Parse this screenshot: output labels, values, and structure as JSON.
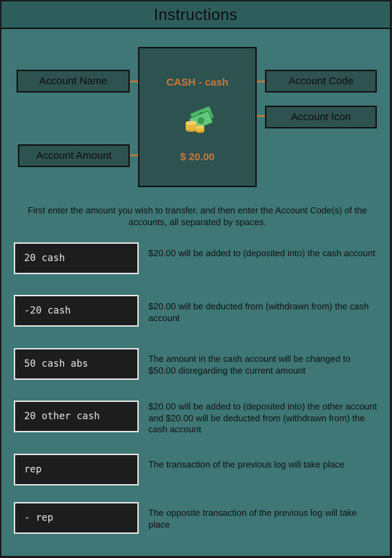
{
  "title": "Instructions",
  "card": {
    "name": "CASH - cash",
    "amount": "$ 20.00",
    "icon": "cash-coins-icon"
  },
  "labels": {
    "account_name": "Account Name",
    "account_code": "Account Code",
    "account_icon": "Account Icon",
    "account_amount": "Account Amount"
  },
  "intro": "First enter the amount you wish to transfer, and then enter the Account Code(s) of the accounts, all separated by spaces.",
  "examples": [
    {
      "command": "20 cash",
      "description": "$20.00 will be added to (deposited into) the cash account"
    },
    {
      "command": "-20 cash",
      "description": "$20.00 will be deducted from (withdrawn from) the cash account"
    },
    {
      "command": "50 cash abs",
      "description": "The amount in the cash account will be changed to $50.00 disregarding the current amount"
    },
    {
      "command": "20 other cash",
      "description": "$20.00 will be added to (deposited into) the other account and $20.00 will be deducted from (withdrawn from) the cash account"
    },
    {
      "command": "rep",
      "description": "The transaction of the previous log will take place"
    },
    {
      "command": "- rep",
      "description": "The opposite transaction of the previous log will take place"
    }
  ],
  "colors": {
    "background": "#3e7775",
    "title_bar": "#2e5e5c",
    "card": "#2e5250",
    "accent": "#c8783a",
    "command_bg": "#1d1d1d"
  }
}
